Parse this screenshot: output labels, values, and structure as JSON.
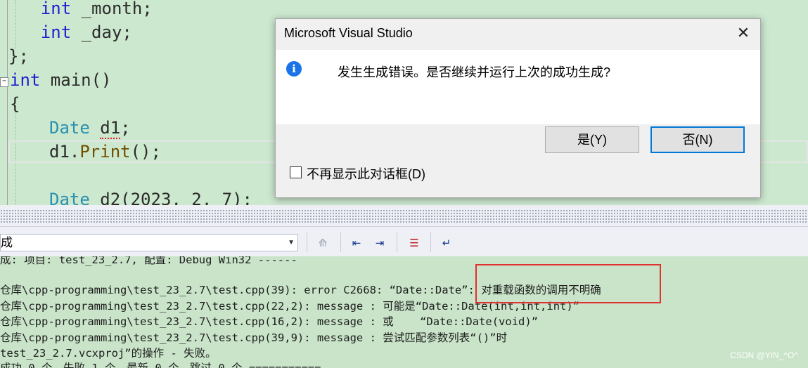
{
  "editor": {
    "lines": [
      {
        "indent": "    ",
        "kw": "int",
        "rest": " _month;"
      },
      {
        "indent": "    ",
        "kw": "int",
        "rest": " _day;"
      },
      {
        "text": "};"
      },
      {
        "kw": "int",
        "rest": " main()"
      },
      {
        "text": "{"
      },
      {
        "type": "Date",
        "var": "d1",
        "end": ";"
      },
      {
        "obj": "d1.",
        "fn": "Print",
        "end": "();"
      },
      {
        "text": ""
      },
      {
        "type": "Date",
        "rest": " d2(2023, 2, 7);"
      }
    ]
  },
  "output_panel": {
    "combo_value": "成",
    "lines": [
      "成: 项目: test_23_2.7, 配置: Debug Win32 ------",
      "",
      "仓库\\cpp-programming\\test_23_2.7\\test.cpp(39): error C2668: “Date::Date”: 对重载函数的调用不明确",
      "仓库\\cpp-programming\\test_23_2.7\\test.cpp(22,2): message : 可能是“Date::Date(int,int,int)”",
      "仓库\\cpp-programming\\test_23_2.7\\test.cpp(16,2): message : 或    “Date::Date(void)”",
      "仓库\\cpp-programming\\test_23_2.7\\test.cpp(39,9): message : 尝试匹配参数列表“()”时",
      "test_23_2.7.vcxproj”的操作 - 失败。",
      "成功 0 个，失败 1 个，最新 0 个，跳过 0 个 ==========="
    ]
  },
  "dialog": {
    "title": "Microsoft Visual Studio",
    "message": "发生生成错误。是否继续并运行上次的成功生成?",
    "yes_label": "是(Y)",
    "no_label": "否(N)",
    "checkbox_label": "不再显示此对话框(D)"
  },
  "watermark": "CSDN @YIN_^O^"
}
